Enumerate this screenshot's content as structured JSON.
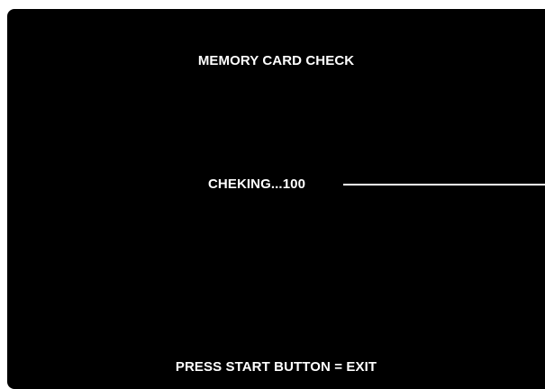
{
  "screen": {
    "title": "MEMORY CARD CHECK",
    "status": {
      "label": "CHEKING...",
      "value": "100"
    },
    "progress": {
      "fraction": 1.0
    },
    "footer": "PRESS START BUTTON = EXIT"
  },
  "colors": {
    "background": "#000000",
    "text": "#ffffff"
  }
}
